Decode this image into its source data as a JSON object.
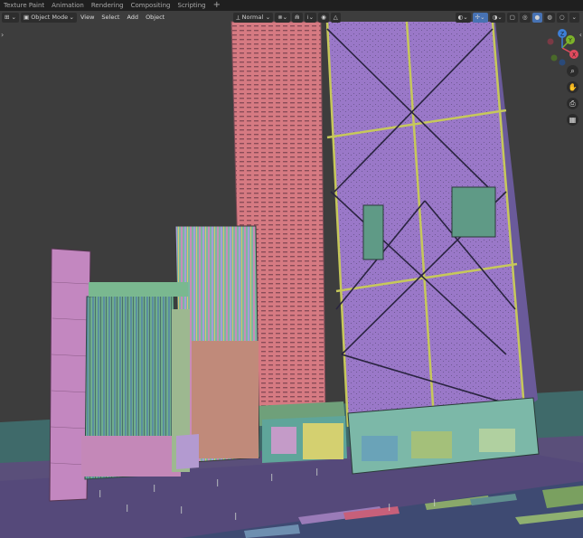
{
  "workspace_tabs": [
    {
      "label": "Texture Paint"
    },
    {
      "label": "Animation"
    },
    {
      "label": "Rendering"
    },
    {
      "label": "Compositing"
    },
    {
      "label": "Scripting"
    }
  ],
  "workspace_add_label": "+",
  "header": {
    "editor_type_icon": "3d-viewport-icon",
    "mode_label": "Object Mode",
    "menus": [
      "View",
      "Select",
      "Add",
      "Object"
    ],
    "orientation_label": "Normal"
  },
  "gizmo": {
    "x_label": "X",
    "y_label": "Y",
    "z_label": "Z"
  },
  "colors": {
    "viewport_bg": "#3d3d3d",
    "header_bg": "#1f1f1f",
    "active_button": "#4772b3",
    "x_axis": "#e04b5e",
    "y_axis": "#7db32a",
    "z_axis": "#3d7fd6"
  },
  "nav_tools": [
    "zoom-icon",
    "pan-hand-icon",
    "camera-view-icon",
    "grid-view-icon"
  ]
}
